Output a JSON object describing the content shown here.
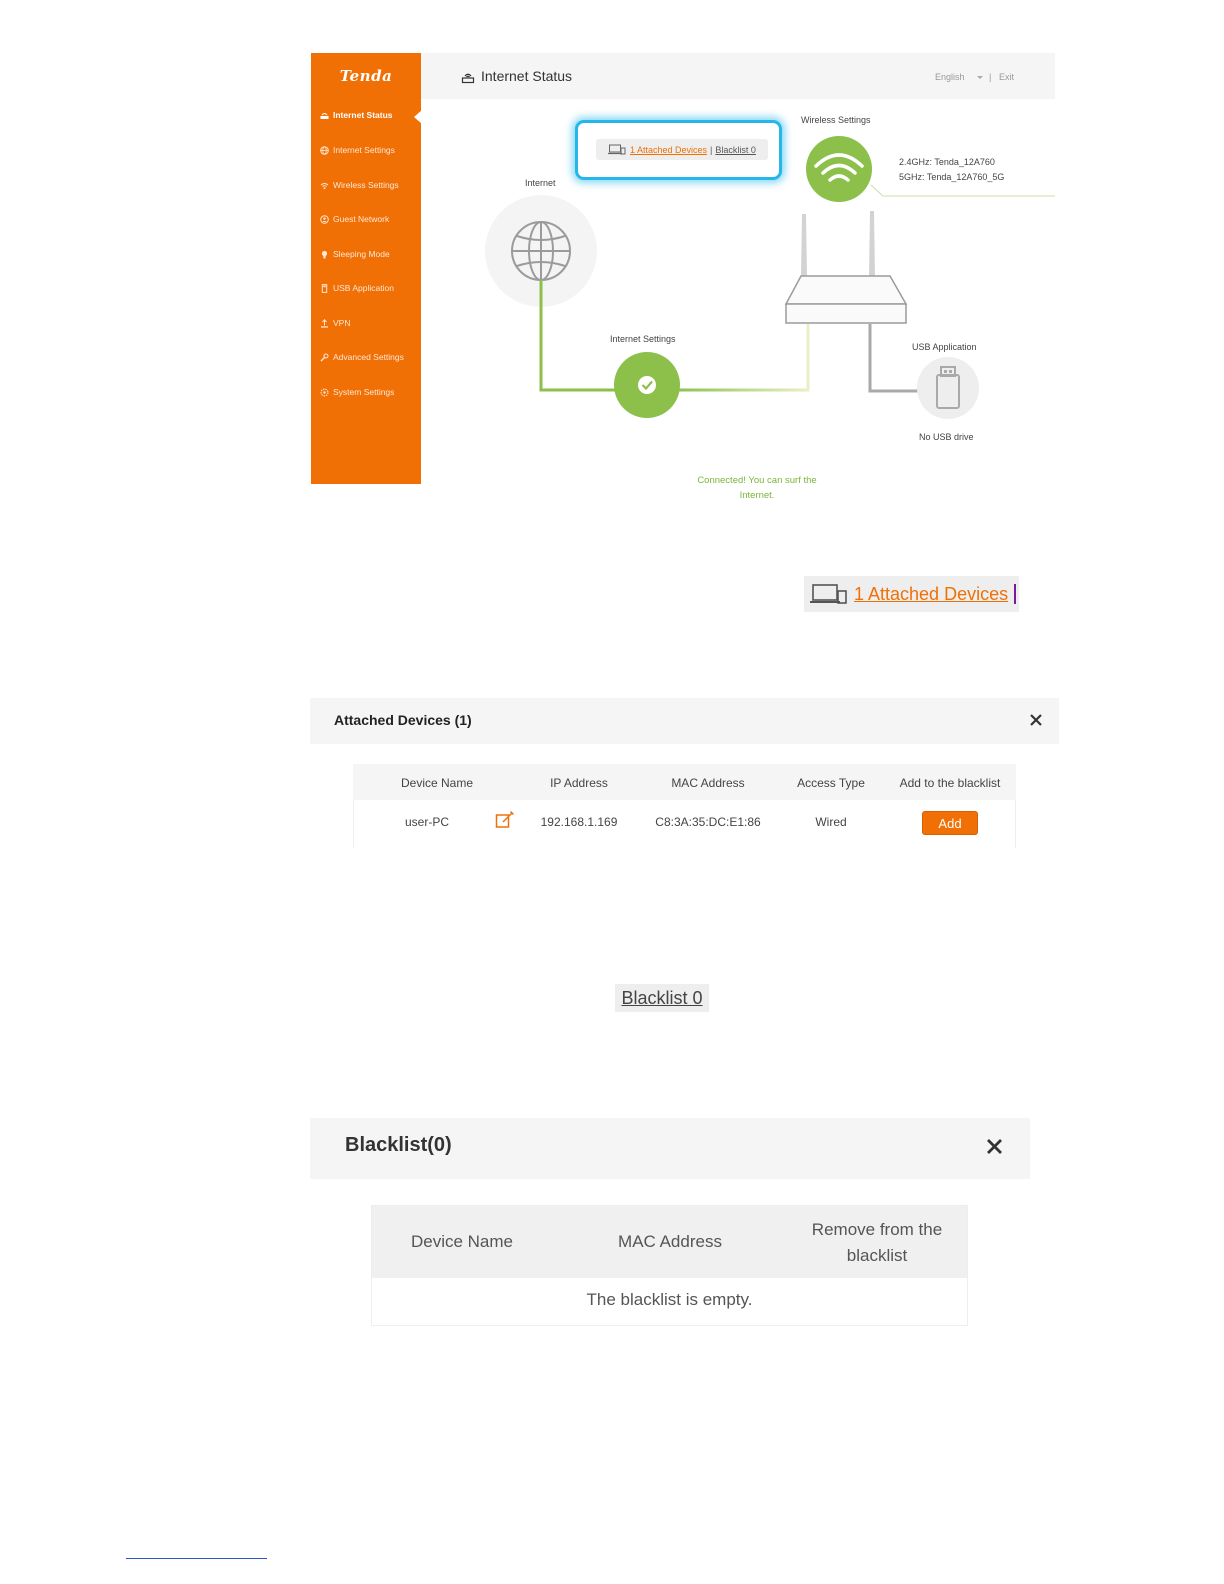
{
  "colors": {
    "accent": "#f07006",
    "green": "#7cb53a",
    "highlight": "#26b7ea"
  },
  "router": {
    "logo": "Tenda",
    "header": {
      "title": "Internet Status",
      "language": "English",
      "separator": "|",
      "exit": "Exit"
    },
    "sidebar": {
      "items": [
        {
          "label": "Internet Status",
          "icon": "router-icon"
        },
        {
          "label": "Internet Settings",
          "icon": "globe-icon"
        },
        {
          "label": "Wireless Settings",
          "icon": "wifi-icon"
        },
        {
          "label": "Guest Network",
          "icon": "guest-icon"
        },
        {
          "label": "Sleeping Mode",
          "icon": "bulb-icon"
        },
        {
          "label": "USB Application",
          "icon": "usb-icon"
        },
        {
          "label": "VPN",
          "icon": "vpn-icon"
        },
        {
          "label": "Advanced Settings",
          "icon": "wrench-icon"
        },
        {
          "label": "System Settings",
          "icon": "gear-icon"
        }
      ]
    },
    "diagram": {
      "attached_link": "1 Attached Devices",
      "link_separator": "|",
      "blacklist_link": "Blacklist 0",
      "wireless_label": "Wireless Settings",
      "ssid_24": "2.4GHz: Tenda_12A760",
      "ssid_5": "5GHz: Tenda_12A760_5G",
      "internet_label": "Internet",
      "internet_settings_label": "Internet Settings",
      "connected_line1": "Connected! You can surf the",
      "connected_line2": "Internet.",
      "usb_label": "USB Application",
      "usb_status": "No USB drive"
    }
  },
  "zoom_attached": {
    "text": "1 Attached Devices"
  },
  "attached_dialog": {
    "title": "Attached Devices (1)",
    "columns": [
      "Device Name",
      "IP Address",
      "MAC Address",
      "Access Type",
      "Add to the blacklist"
    ],
    "rows": [
      {
        "device_name": "user-PC",
        "ip": "192.168.1.169",
        "mac": "C8:3A:35:DC:E1:86",
        "access": "Wired",
        "action": "Add"
      }
    ]
  },
  "zoom_blacklist": {
    "text": "Blacklist 0"
  },
  "blacklist_dialog": {
    "title": "Blacklist(0)",
    "columns": [
      "Device Name",
      "MAC Address",
      "Remove from the",
      "blacklist"
    ],
    "empty": "The blacklist is empty."
  }
}
